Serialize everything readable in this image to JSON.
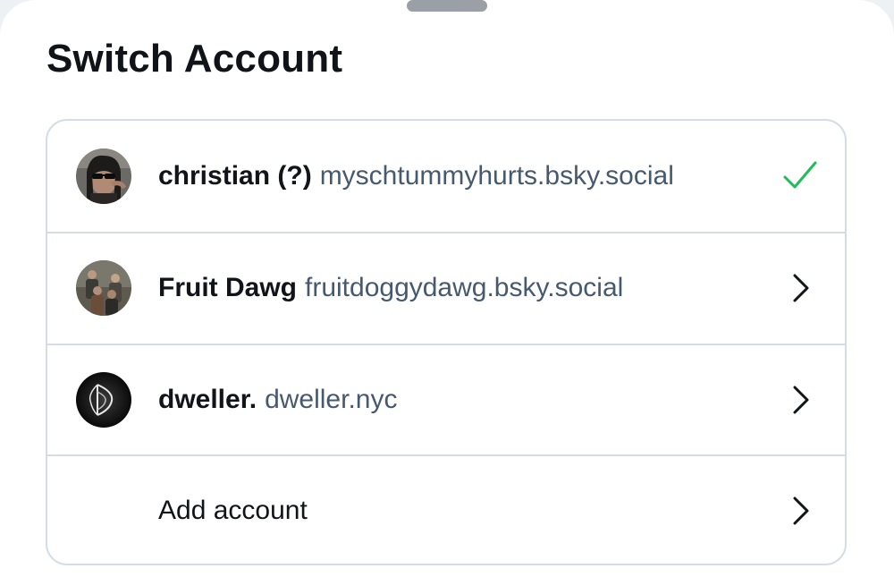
{
  "sheet": {
    "title": "Switch Account"
  },
  "accounts": [
    {
      "display_name": "christian (?)",
      "handle": "myschtummyhurts.bsky.social",
      "selected": true,
      "avatar_icon": "profile-photo"
    },
    {
      "display_name": "Fruit Dawg",
      "handle": "fruitdoggydawg.bsky.social",
      "selected": false,
      "avatar_icon": "group-photo"
    },
    {
      "display_name": "dweller.",
      "handle": "dweller.nyc",
      "selected": false,
      "avatar_icon": "logo-mark"
    }
  ],
  "add_account": {
    "label": "Add account"
  },
  "colors": {
    "check": "#20bc5a",
    "border": "#d4dde6",
    "handle": "#46596e",
    "text": "#111418"
  }
}
